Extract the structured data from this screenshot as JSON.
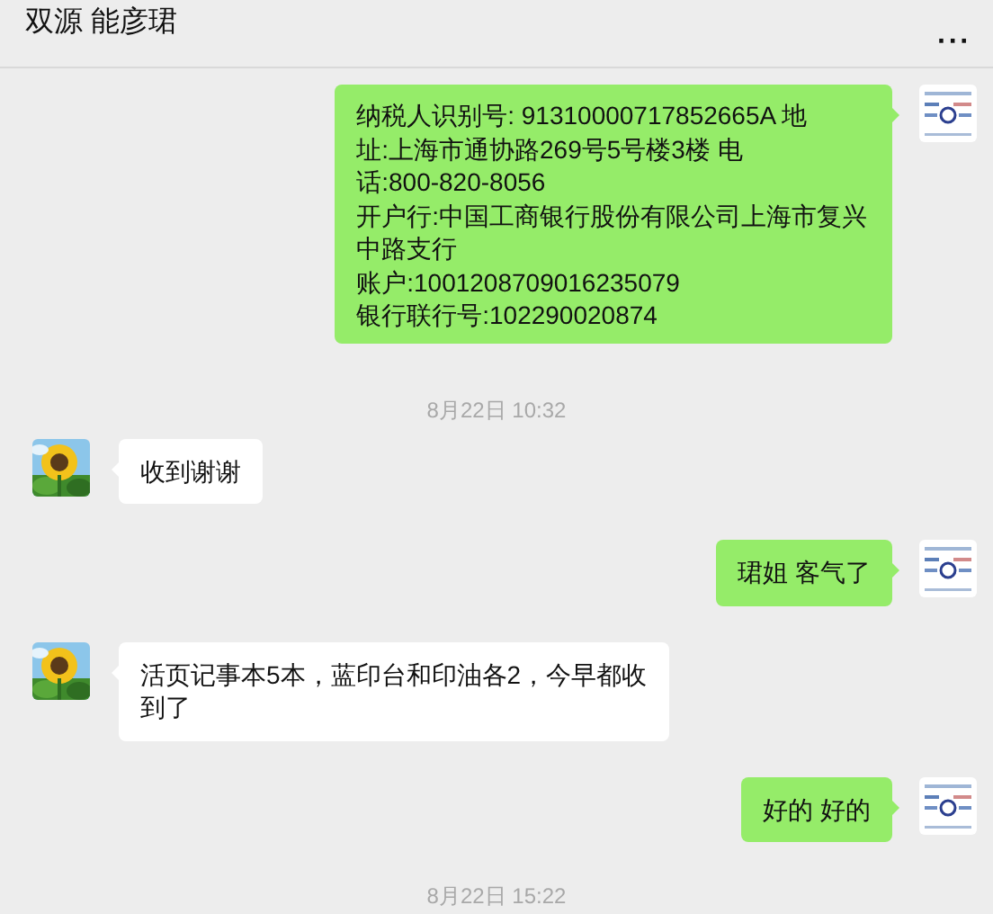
{
  "header": {
    "title": "双源 能彦珺",
    "menu": "···"
  },
  "messages": [
    {
      "kind": "text",
      "outgoing": true,
      "lines": [
        "纳税人识别号: 91310000717852665A    地",
        "址:上海市通协路269号5号楼3楼  电",
        "话:800-820-8056",
        "开户行:中国工商银行股份有限公司上海市复兴",
        "中路支行",
        "账户:1001208709016235079",
        "银行联行号:102290020874"
      ]
    },
    {
      "kind": "time",
      "text": "8月22日 10:32"
    },
    {
      "kind": "text",
      "outgoing": false,
      "lines": [
        "收到谢谢"
      ]
    },
    {
      "kind": "text",
      "outgoing": true,
      "lines": [
        "珺姐 客气了"
      ]
    },
    {
      "kind": "text",
      "outgoing": false,
      "lines": [
        "活页记事本5本，蓝印台和印油各2，今早都收",
        "到了"
      ]
    },
    {
      "kind": "text",
      "outgoing": true,
      "lines": [
        "好的 好的"
      ]
    },
    {
      "kind": "time",
      "text": "8月22日 15:22"
    }
  ]
}
